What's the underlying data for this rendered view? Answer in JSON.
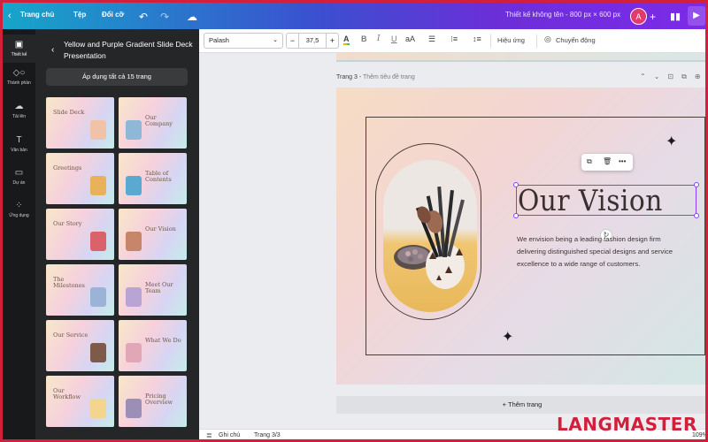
{
  "topbar": {
    "home_label": "Trang chủ",
    "file_label": "Tệp",
    "resize_label": "Đổi cỡ",
    "design_title": "Thiết kế không tên - 800 px × 600 px",
    "avatar_initial": "A",
    "icons": [
      "chevron-left-icon",
      "undo-icon",
      "redo-icon",
      "cloud-icon",
      "plus-icon",
      "bar-chart-icon",
      "play-icon"
    ]
  },
  "rail": [
    {
      "label": "Thiết kế",
      "icon": "layout-icon",
      "active": true
    },
    {
      "label": "Thành phần",
      "icon": "shapes-icon"
    },
    {
      "label": "Tải lên",
      "icon": "upload-icon"
    },
    {
      "label": "Văn bản",
      "icon": "text-icon"
    },
    {
      "label": "Dự án",
      "icon": "folder-icon"
    },
    {
      "label": "Ứng dụng",
      "icon": "apps-icon"
    }
  ],
  "panel": {
    "title": "Yellow and Purple Gradient Slide Deck Presentation",
    "apply_all": "Áp dụng tất cả 15 trang",
    "thumbnails": [
      "Slide Deck",
      "Our Company",
      "Greetings",
      "Table of Contents",
      "Our Story",
      "Our Vision",
      "The Milestones",
      "Meet Our Team",
      "Our Service",
      "What We Do",
      "Our Workflow",
      "Pricing Overview"
    ]
  },
  "toolbar": {
    "font": "Palash",
    "size_minus": "−",
    "size": "37,5",
    "size_plus": "+",
    "color_glyph": "A",
    "bold": "B",
    "italic": "I",
    "underline": "U",
    "case": "aA",
    "effects": "Hiệu ứng",
    "animate": "Chuyển động"
  },
  "canvas": {
    "page_label": "Trang 3",
    "page_subtitle": "Thêm tiêu đề trang",
    "heading": "Our Vision",
    "body": "We envision being a leading fashion design firm delivering distinguished special designs and service excellence to a wide range of customers.",
    "add_page": "+ Thêm trang"
  },
  "bottombar": {
    "notes": "Ghi chú",
    "pages": "Trang 3/3",
    "zoom": "109%"
  },
  "watermark": "LANGMASTER",
  "colors": {
    "accent": "#8b3dff",
    "panel_bg": "#252627",
    "rail_bg": "#18191b",
    "frame": "#d21f3c"
  }
}
